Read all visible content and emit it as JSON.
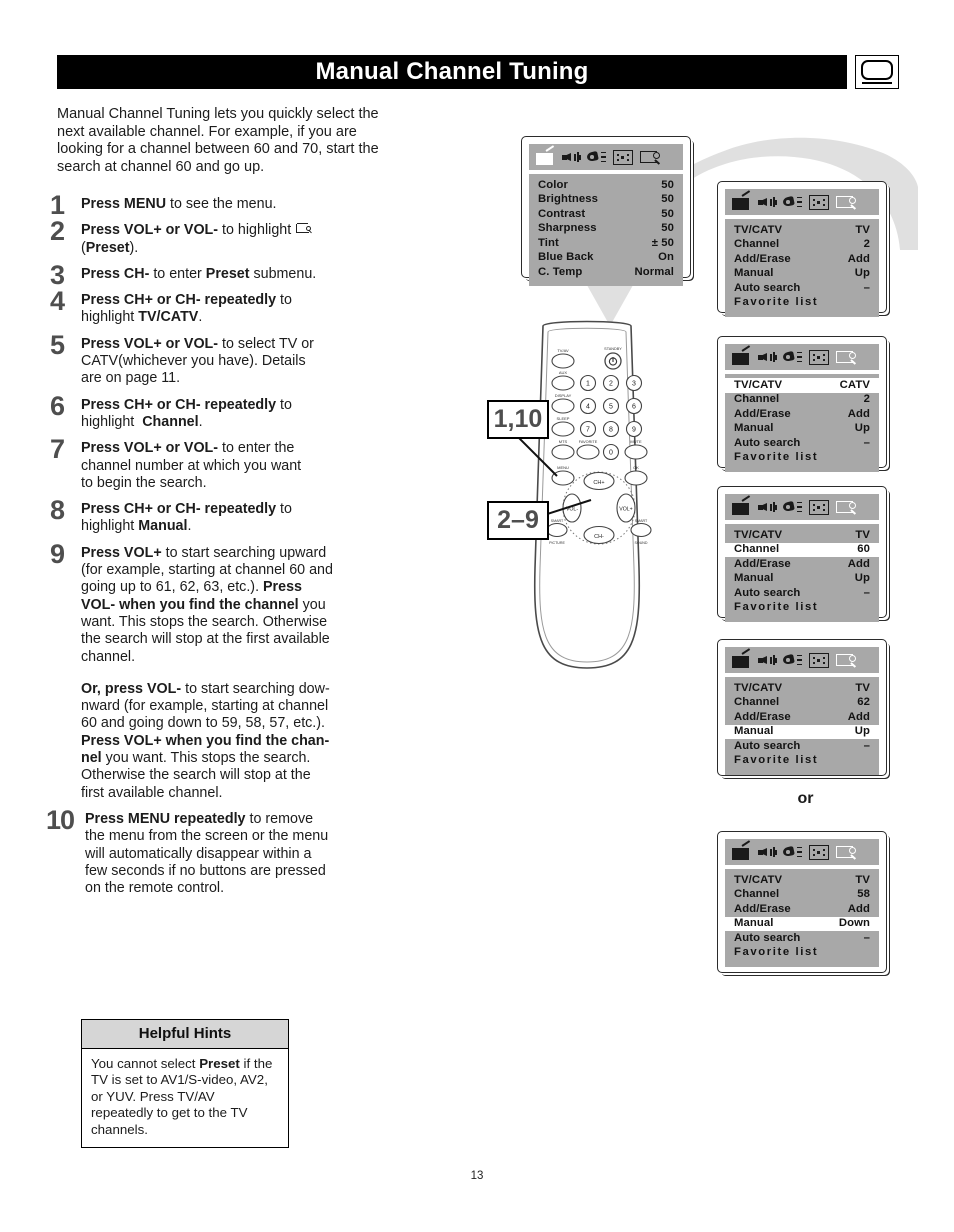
{
  "header": {
    "title": "Manual Channel Tuning",
    "tv_icon": "tv-screen-icon"
  },
  "intro": "Manual Channel Tuning lets you quickly select the next available channel. For example, if you are looking for a channel between 60 and 70, start the search at channel 60 and go up.",
  "steps": [
    {
      "num": "1",
      "html": "<b>Press MENU</b> to see the menu."
    },
    {
      "num": "2",
      "html": "<b>Press VOL+ or VOL-</b> to highlight <span class=\"inline-preset-icon\"><span class=\"bx\"></span><span class=\"lens\"></span><span class=\"handle\"></span></span><br>(<b>Preset</b>)."
    },
    {
      "num": "3",
      "html": "<b>Press CH-</b> to enter <b>Preset</b> submenu."
    },
    {
      "num": "4",
      "html": "<b>Press CH+ or CH- repeatedly</b> to<br>highlight <b>TV/CATV</b>."
    },
    {
      "num": "5",
      "html": "<b>Press VOL+ or VOL-</b> to select TV or<br>CATV(whichever you have). Details<br>are on page 11."
    },
    {
      "num": "6",
      "html": "<b>Press CH+ or CH- repeatedly</b> to<br>highlight &nbsp;<b>Channel</b>."
    },
    {
      "num": "7",
      "html": "<b>Press VOL+ or VOL-</b> to enter the<br>channel number at which you want<br>to begin the search."
    },
    {
      "num": "8",
      "html": "<b>Press CH+ or CH- repeatedly</b> to<br>highlight <b>Manual</b>."
    },
    {
      "num": "9",
      "html": "<b>Press VOL+</b> to start searching upward<br>(for example, starting at channel 60 and<br>going up to 61, 62, 63, etc.). <b>Press<br>VOL- when you find the channel</b> you<br>want. This stops the search. Otherwise<br>the search will stop at the first available<br>channel.<div class=\"para-gap\"></div><b>Or, press VOL-</b> to start searching dow-<br>nward (for example, starting at channel<br>60 and going down to 59, 58, 57, etc.).<br><b>Press VOL+ when you find the chan-<br>nel</b> you want. This stops the search.<br>Otherwise the search will stop at the<br>first available channel."
    },
    {
      "num": "10",
      "html": "<b>Press MENU repeatedly</b> to remove<br>the menu from the screen or the menu<br>will automatically disappear within a<br>few seconds if no buttons are pressed<br>on the remote control."
    }
  ],
  "hints": {
    "title": "Helpful Hints",
    "html": "You cannot select <b>Preset</b> if the TV is set to AV1/S-video, AV2, or YUV. Press TV/AV repeatedly to get to the TV channels."
  },
  "page_number": "13",
  "or_label": "or",
  "osd_icons": [
    "picture-tv-icon",
    "sound-speaker-icon",
    "feature-brush-icon",
    "timer-clock-icon",
    "preset-magnifier-icon"
  ],
  "osd_screens": [
    {
      "id": "picture-menu",
      "active_icon": 0,
      "rows": [
        {
          "label": "Color",
          "value": "50",
          "highlighted": false
        },
        {
          "label": "Brightness",
          "value": "50",
          "highlighted": false
        },
        {
          "label": "Contrast",
          "value": "50",
          "highlighted": false
        },
        {
          "label": "Sharpness",
          "value": "50",
          "highlighted": false
        },
        {
          "label": "Tint",
          "value": "± 50",
          "highlighted": false
        },
        {
          "label": "Blue Back",
          "value": "On",
          "highlighted": false
        },
        {
          "label": "C. Temp",
          "value": "Normal",
          "highlighted": false
        }
      ]
    },
    {
      "id": "preset-menu-1",
      "active_icon": 4,
      "rows": [
        {
          "label": "TV/CATV",
          "value": "TV",
          "highlighted": false
        },
        {
          "label": "Channel",
          "value": "2",
          "highlighted": false
        },
        {
          "label": "Add/Erase",
          "value": "Add",
          "highlighted": false
        },
        {
          "label": "Manual",
          "value": "Up",
          "highlighted": false
        },
        {
          "label": "Auto search",
          "value": "–",
          "highlighted": false
        },
        {
          "label": "Favorite list",
          "value": "",
          "highlighted": false,
          "spread": true
        }
      ]
    },
    {
      "id": "preset-menu-2-catv",
      "active_icon": 4,
      "rows": [
        {
          "label": "TV/CATV",
          "value": "CATV",
          "highlighted": true
        },
        {
          "label": "Channel",
          "value": "2",
          "highlighted": false
        },
        {
          "label": "Add/Erase",
          "value": "Add",
          "highlighted": false
        },
        {
          "label": "Manual",
          "value": "Up",
          "highlighted": false
        },
        {
          "label": "Auto search",
          "value": "–",
          "highlighted": false
        },
        {
          "label": "Favorite list",
          "value": "",
          "highlighted": false,
          "spread": true
        }
      ]
    },
    {
      "id": "preset-menu-3-channel60",
      "active_icon": 4,
      "rows": [
        {
          "label": "TV/CATV",
          "value": "TV",
          "highlighted": false
        },
        {
          "label": "Channel",
          "value": "60",
          "highlighted": true
        },
        {
          "label": "Add/Erase",
          "value": "Add",
          "highlighted": false
        },
        {
          "label": "Manual",
          "value": "Up",
          "highlighted": false
        },
        {
          "label": "Auto search",
          "value": "–",
          "highlighted": false
        },
        {
          "label": "Favorite list",
          "value": "",
          "highlighted": false,
          "spread": true
        }
      ]
    },
    {
      "id": "preset-menu-4-manual-up",
      "active_icon": 4,
      "rows": [
        {
          "label": "TV/CATV",
          "value": "TV",
          "highlighted": false
        },
        {
          "label": "Channel",
          "value": "62",
          "highlighted": false
        },
        {
          "label": "Add/Erase",
          "value": "Add",
          "highlighted": false
        },
        {
          "label": "Manual",
          "value": "Up",
          "highlighted": true
        },
        {
          "label": "Auto search",
          "value": "–",
          "highlighted": false
        },
        {
          "label": "Favorite list",
          "value": "",
          "highlighted": false,
          "spread": true
        }
      ]
    },
    {
      "id": "preset-menu-5-manual-down",
      "active_icon": 4,
      "rows": [
        {
          "label": "TV/CATV",
          "value": "TV",
          "highlighted": false
        },
        {
          "label": "Channel",
          "value": "58",
          "highlighted": false
        },
        {
          "label": "Add/Erase",
          "value": "Add",
          "highlighted": false
        },
        {
          "label": "Manual",
          "value": "Down",
          "highlighted": true
        },
        {
          "label": "Auto search",
          "value": "–",
          "highlighted": false
        },
        {
          "label": "Favorite list",
          "value": "",
          "highlighted": false,
          "spread": true
        }
      ]
    }
  ],
  "remote": {
    "callout_top": "1,10",
    "callout_bottom": "2–9",
    "buttons": {
      "tv_video": "TV/AV",
      "standby": "STANDBY",
      "aux": "AUX",
      "display": "DISPLAY",
      "sleep": "SLEEP",
      "mts": "MTS",
      "favorite": "FAVORITE",
      "mute": "MUTE",
      "menu": "MENU",
      "ok": "OK",
      "ch_up": "CH+",
      "ch_down": "CH-",
      "vol_down": "VOL-",
      "vol_up": "VOL+",
      "smart_picture": "SMART PICTURE",
      "smart_sound": "SMART SOUND",
      "digits": [
        "1",
        "2",
        "3",
        "4",
        "5",
        "6",
        "7",
        "8",
        "9",
        "0"
      ]
    }
  },
  "colors": {
    "header_bg": "#000000",
    "header_text": "#ffffff",
    "osd_bg": "#a8a8a8",
    "osd_highlight": "#ffffff",
    "hint_title_bg": "#d6d6d6",
    "step_number": "#4e4e4e",
    "arrow_gray": "#e0e0e0"
  }
}
